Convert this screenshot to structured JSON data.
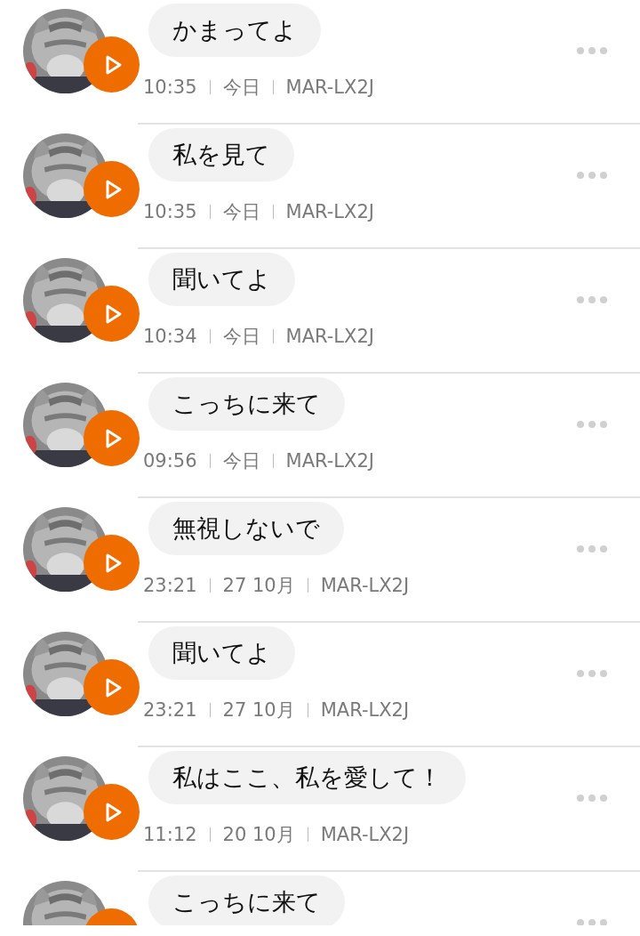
{
  "messages": [
    {
      "text": "かまってよ",
      "time": "10:35",
      "date": "今日",
      "device": "MAR-LX2J"
    },
    {
      "text": "私を見て",
      "time": "10:35",
      "date": "今日",
      "device": "MAR-LX2J"
    },
    {
      "text": "聞いてよ",
      "time": "10:34",
      "date": "今日",
      "device": "MAR-LX2J"
    },
    {
      "text": "こっちに来て",
      "time": "09:56",
      "date": "今日",
      "device": "MAR-LX2J"
    },
    {
      "text": "無視しないで",
      "time": "23:21",
      "date": "27 10月",
      "device": "MAR-LX2J"
    },
    {
      "text": "聞いてよ",
      "time": "23:21",
      "date": "27 10月",
      "device": "MAR-LX2J"
    },
    {
      "text": "私はここ、私を愛して！",
      "time": "11:12",
      "date": "20 10月",
      "device": "MAR-LX2J"
    },
    {
      "text": "こっちに来て"
    }
  ]
}
